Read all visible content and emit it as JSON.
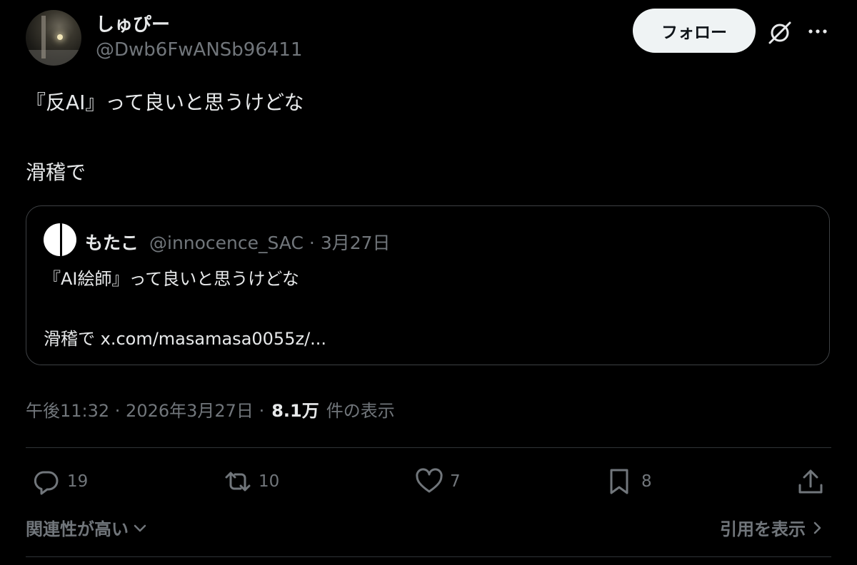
{
  "author": {
    "display_name": "しゅぴー",
    "handle": "@Dwb6FwANSb96411",
    "follow_label": "フォロー"
  },
  "post": {
    "line1": "『反AI』って良いと思うけどな",
    "line2": "滑稽で"
  },
  "quoted": {
    "display_name": "もたこ",
    "handle_date": "@innocence_SAC · 3月27日",
    "line1": "『AI絵師』って良いと思うけどな",
    "line2": "滑稽で x.com/masamasa0055z/..."
  },
  "meta": {
    "timestamp": "午後11:32 · 2026年3月27日 ·",
    "views": "8.1万",
    "views_label": "件の表示"
  },
  "actions": {
    "replies": "19",
    "reposts": "10",
    "likes": "7",
    "bookmarks": "8"
  },
  "footer": {
    "sort_label": "関連性が高い",
    "quotes_label": "引用を表示"
  },
  "icons": [
    "grok-icon",
    "more-icon",
    "reply-icon",
    "repost-icon",
    "like-icon",
    "bookmark-icon",
    "share-icon",
    "chevron-down-icon",
    "chevron-right-icon"
  ],
  "colors": {
    "background": "#000000",
    "text": "#e7e9ea",
    "secondary": "#71767b",
    "border": "#2f3336",
    "button": "#eff3f4"
  }
}
